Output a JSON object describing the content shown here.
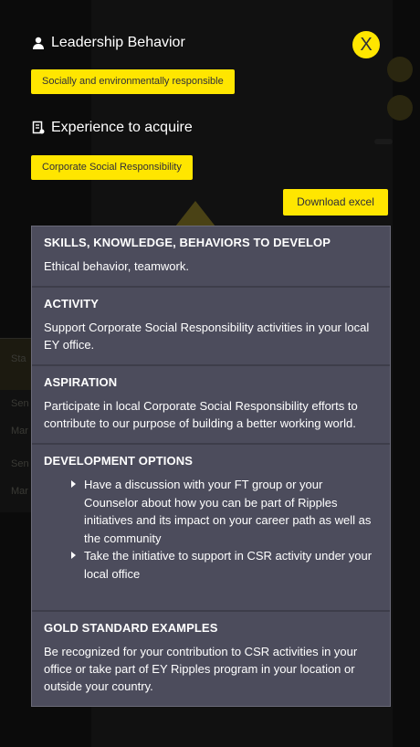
{
  "leadership": {
    "title": "Leadership Behavior",
    "value": "Socially and environmentally responsible"
  },
  "experience": {
    "title": "Experience to acquire",
    "value": "Corporate Social Responsibility"
  },
  "close_label": "X",
  "download_label": "Download excel",
  "background": {
    "table_header": "Sta",
    "rows": [
      "Sen",
      "Mar",
      "Sen",
      "Mar"
    ]
  },
  "panel": {
    "skills": {
      "heading": "SKILLS, KNOWLEDGE, BEHAVIORS TO DEVELOP",
      "text": "Ethical behavior, teamwork."
    },
    "activity": {
      "heading": "ACTIVITY",
      "text": "Support Corporate Social Responsibility activities in your local EY office."
    },
    "aspiration": {
      "heading": "ASPIRATION",
      "text": "Participate in local Corporate Social Responsibility efforts to contribute to our purpose of building a better working world."
    },
    "development": {
      "heading": "DEVELOPMENT OPTIONS",
      "items": [
        "Have a discussion with your FT group or your Counselor about how you can be part of Ripples initiatives and its impact on your career path as well as the community",
        "Take the initiative to support in CSR activity under your local office"
      ]
    },
    "gold": {
      "heading": "GOLD STANDARD EXAMPLES",
      "text": "Be recognized for your contribution to CSR activities in your office or take part of EY Ripples program in your location or outside your country."
    }
  }
}
